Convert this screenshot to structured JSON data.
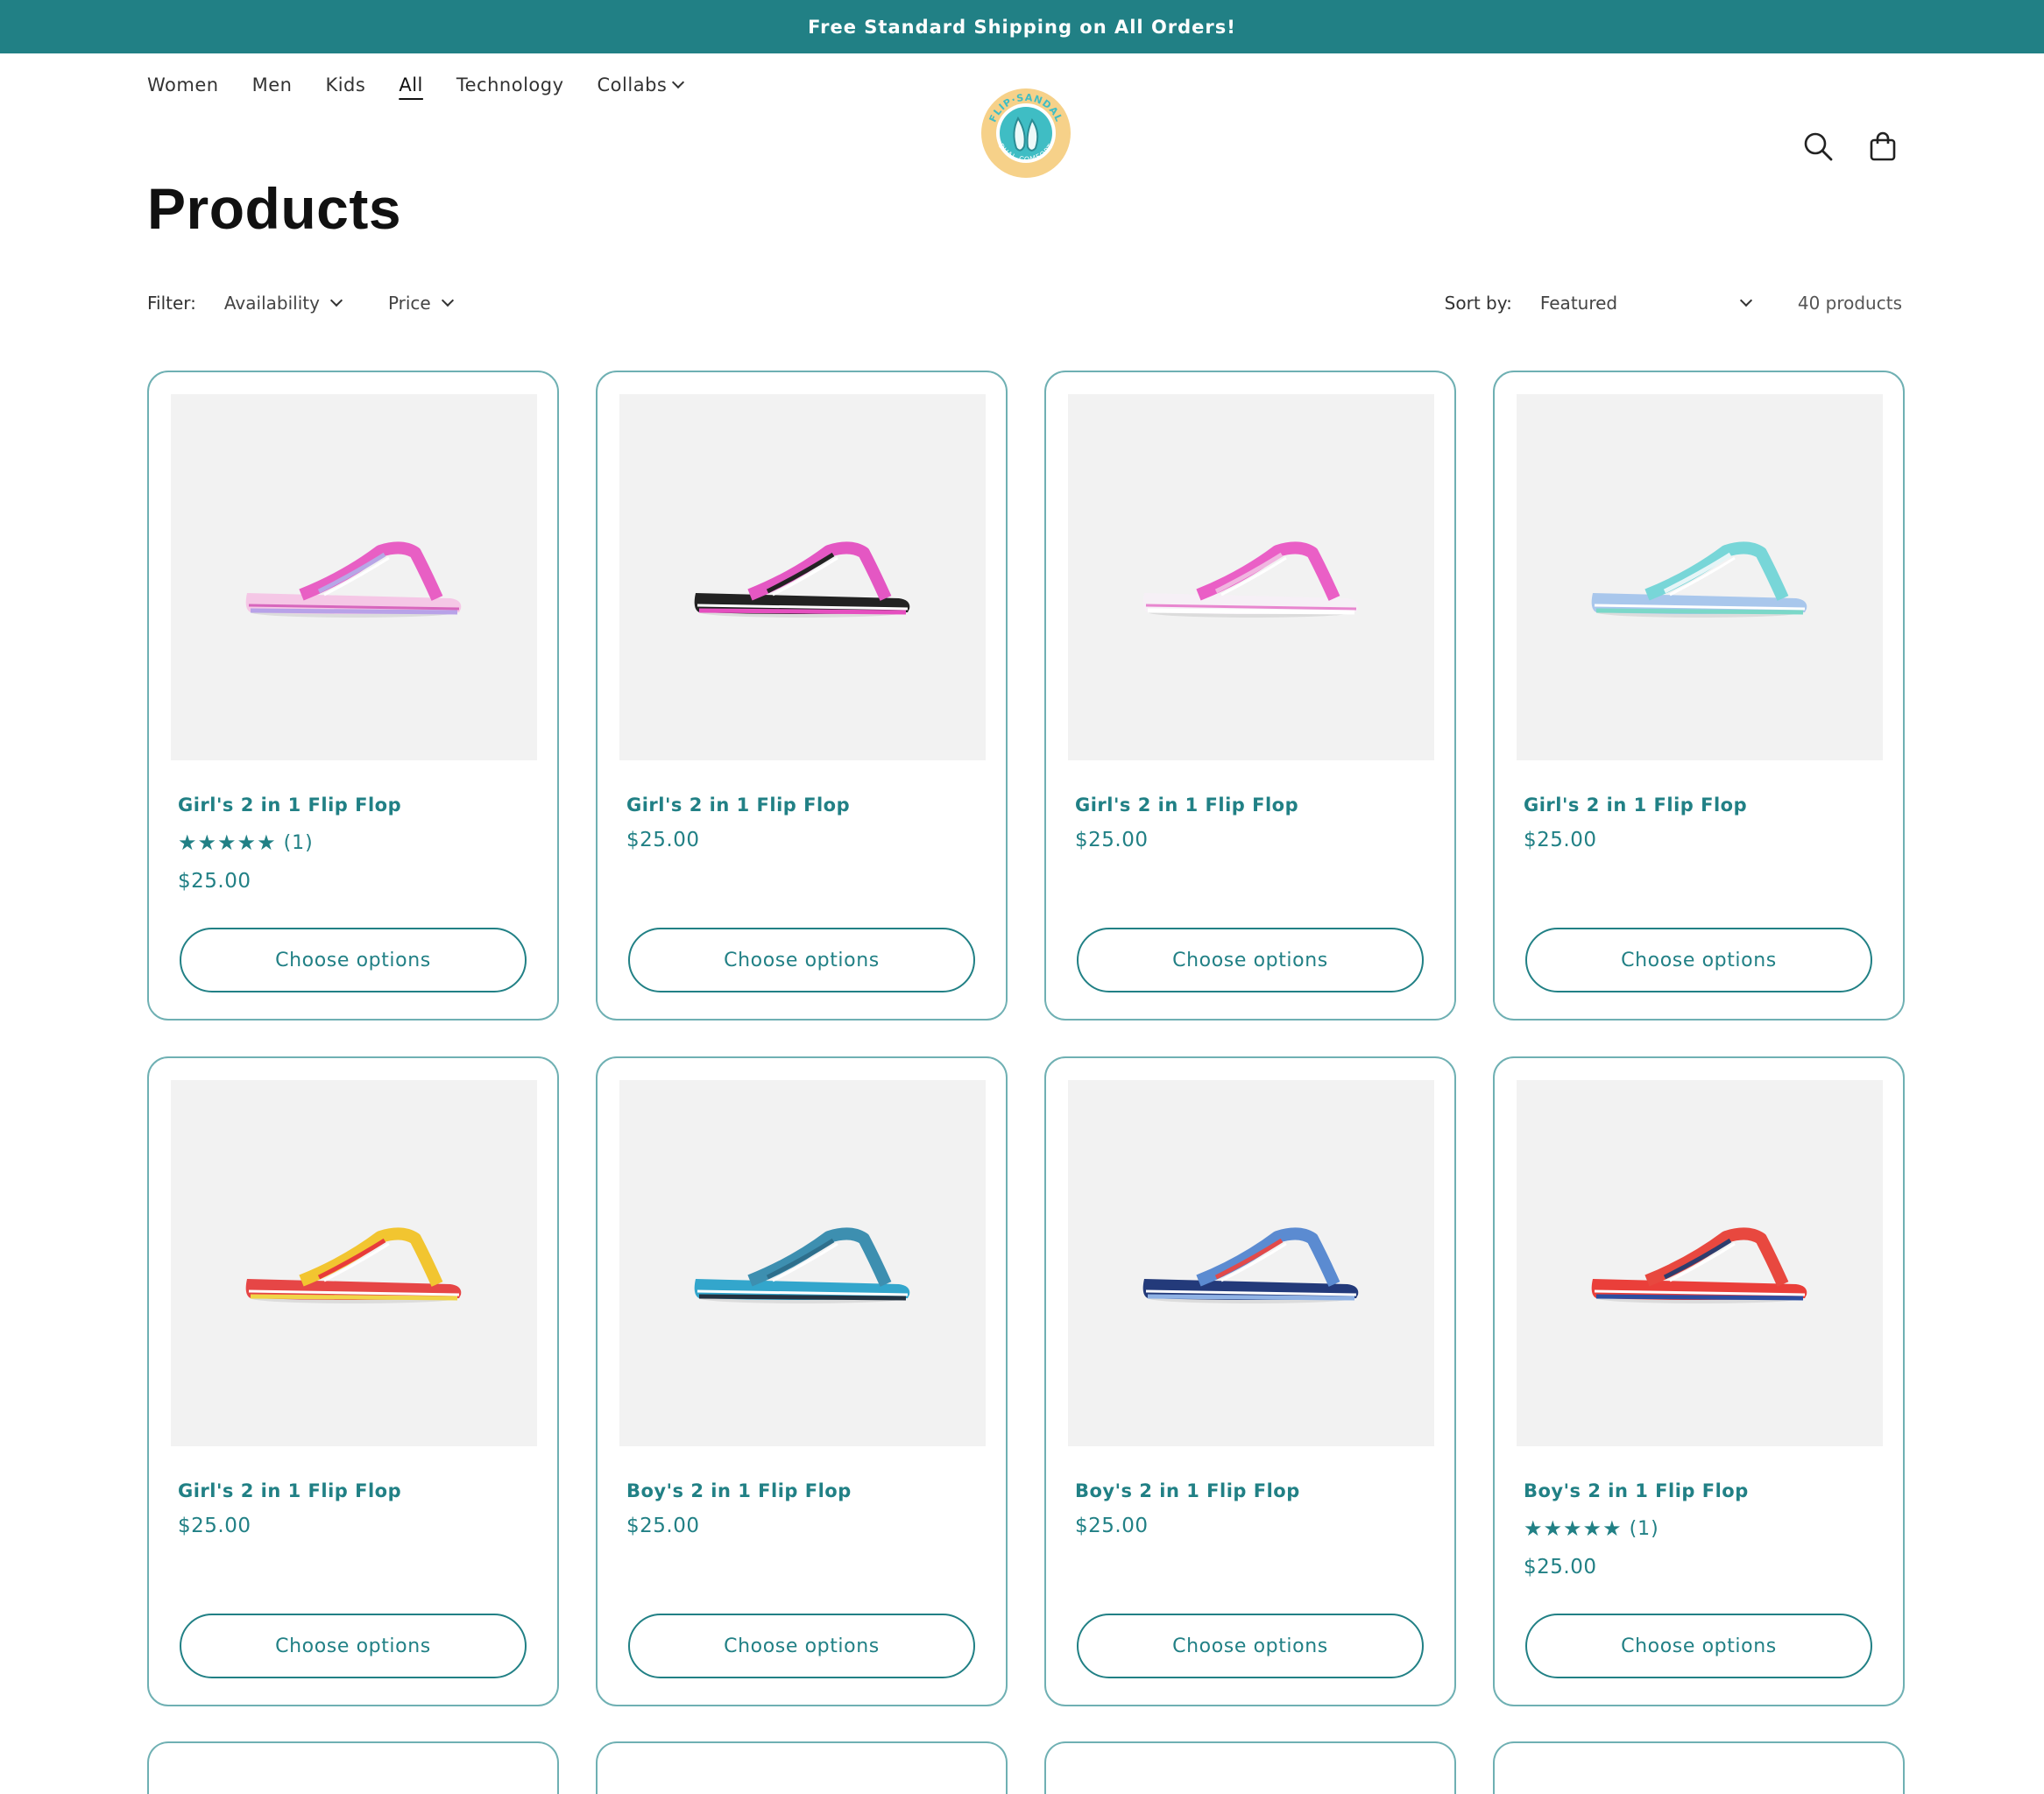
{
  "announcement": "Free Standard Shipping on All Orders!",
  "nav": {
    "items": [
      {
        "label": "Women",
        "name": "nav-women"
      },
      {
        "label": "Men",
        "name": "nav-men"
      },
      {
        "label": "Kids",
        "name": "nav-kids"
      },
      {
        "label": "All",
        "name": "nav-all",
        "active": true
      },
      {
        "label": "Technology",
        "name": "nav-technology"
      },
      {
        "label": "Collabs",
        "name": "nav-collabs",
        "dropdown": true
      }
    ]
  },
  "logo": {
    "text_top": "FLIP·SANDAL",
    "text_bottom": "DUAL COMFORT",
    "colors": {
      "ring": "#f6d189",
      "center": "#3fbdc4"
    }
  },
  "icons": {
    "search": "search-icon",
    "cart": "cart-icon"
  },
  "page_title": "Products",
  "filters": {
    "label": "Filter:",
    "availability": "Availability",
    "price": "Price",
    "sort_label": "Sort by:",
    "sort_value": "Featured",
    "count": "40 products"
  },
  "colors": {
    "accent": "#218085",
    "card_border": "#6fb0b3"
  },
  "products": [
    {
      "name": "Girl's 2 in 1 Flip Flop",
      "stars": "★★★★★",
      "review_count": "(1)",
      "price": "$25.00",
      "button": "Choose options",
      "strap": "#e85fc4",
      "strap2": "#b7a7e6",
      "sole": "#f5c7e6",
      "stripe": "#d766bd",
      "base": "#b8a2e8"
    },
    {
      "name": "Girl's 2 in 1 Flip Flop",
      "stars": "",
      "review_count": "",
      "price": "$25.00",
      "button": "Choose options",
      "strap": "#e457c3",
      "strap2": "#222222",
      "sole": "#222222",
      "stripe": "#ffffff",
      "base": "#e54fbf"
    },
    {
      "name": "Girl's 2 in 1 Flip Flop",
      "stars": "",
      "review_count": "",
      "price": "$25.00",
      "button": "Choose options",
      "strap": "#ea5fc6",
      "strap2": "#f0b6e0",
      "sole": "#f6f0f6",
      "stripe": "#e886cf",
      "base": "#ffffff"
    },
    {
      "name": "Girl's 2 in 1 Flip Flop",
      "stars": "",
      "review_count": "",
      "price": "$25.00",
      "button": "Choose options",
      "strap": "#78d6d8",
      "strap2": "#e6f5f7",
      "sole": "#a9c7ec",
      "stripe": "#ffffff",
      "base": "#7bd8c8"
    },
    {
      "name": "Girl's 2 in 1 Flip Flop",
      "stars": "",
      "review_count": "",
      "price": "$25.00",
      "button": "Choose options",
      "strap": "#f2c530",
      "strap2": "#e83b3b",
      "sole": "#e64646",
      "stripe": "#ffffff",
      "base": "#f0d548"
    },
    {
      "name": "Boy's 2 in 1 Flip Flop",
      "stars": "",
      "review_count": "",
      "price": "$25.00",
      "button": "Choose options",
      "strap": "#3d8fb0",
      "strap2": "#2e6f8c",
      "sole": "#33a6cc",
      "stripe": "#ffffff",
      "base": "#233241"
    },
    {
      "name": "Boy's 2 in 1 Flip Flop",
      "stars": "",
      "review_count": "",
      "price": "$25.00",
      "button": "Choose options",
      "strap": "#5b8bd1",
      "strap2": "#e24a4a",
      "sole": "#233a7a",
      "stripe": "#ffffff",
      "base": "#8fb2e5"
    },
    {
      "name": "Boy's 2 in 1 Flip Flop",
      "stars": "★★★★★",
      "review_count": "(1)",
      "price": "$25.00",
      "button": "Choose options",
      "strap": "#e8483f",
      "strap2": "#2d3d6e",
      "sole": "#ea3f3a",
      "stripe": "#ffffff",
      "base": "#2c4da0"
    }
  ]
}
